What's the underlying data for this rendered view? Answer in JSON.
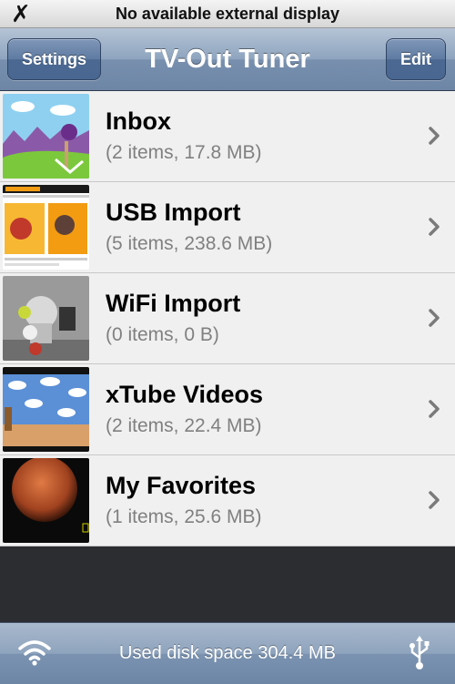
{
  "status_bar": {
    "close_glyph": "✗",
    "message": "No available external display"
  },
  "nav": {
    "left_button": "Settings",
    "title": "TV-Out Tuner",
    "right_button": "Edit"
  },
  "rows": [
    {
      "name": "Inbox",
      "meta": "(2 items, 17.8 MB)",
      "thumbnail": "cartoon-scene-thumbnail"
    },
    {
      "name": "USB Import",
      "meta": "(5 items, 238.6 MB)",
      "thumbnail": "website-screenshot-thumbnail"
    },
    {
      "name": "WiFi Import",
      "meta": "(0 items, 0 B)",
      "thumbnail": "toy-robot-thumbnail"
    },
    {
      "name": "xTube Videos",
      "meta": "(2 items, 22.4 MB)",
      "thumbnail": "cloud-wallpaper-room-thumbnail"
    },
    {
      "name": "My Favorites",
      "meta": "(1 items, 25.6 MB)",
      "thumbnail": "planet-thumbnail"
    }
  ],
  "bottom_bar": {
    "disk_usage": "Used disk space 304.4 MB",
    "left_icon": "wifi-icon",
    "right_icon": "usb-icon"
  },
  "colors": {
    "nav_blue": "#7890ae",
    "row_background": "#f0f0f0",
    "secondary_text": "#808080"
  }
}
